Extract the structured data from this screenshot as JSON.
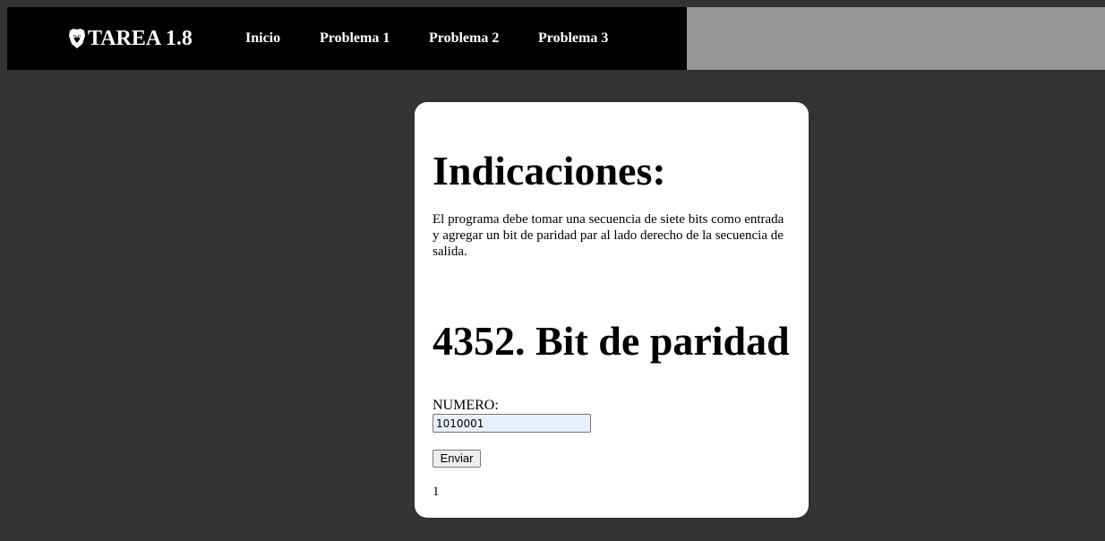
{
  "header": {
    "brand": "TAREA 1.8",
    "brand_icon": "lion-shield-icon",
    "nav": [
      {
        "label": "Inicio"
      },
      {
        "label": "Problema 1"
      },
      {
        "label": "Problema 2"
      },
      {
        "label": "Problema 3"
      }
    ]
  },
  "main": {
    "instructions_title": "Indicaciones:",
    "instructions_text": "El programa debe tomar una secuencia de siete bits como entrada y agregar un bit de paridad par al lado derecho de la secuencia de salida.",
    "problem_title": "4352. Bit de paridad",
    "form": {
      "field_label": "NUMERO:",
      "field_value": "1010001",
      "submit_label": "Enviar"
    },
    "result": "1"
  },
  "colors": {
    "page_bg": "#333333",
    "nav_bg": "#000000",
    "topbar_right_bg": "#969696",
    "card_bg": "#ffffff",
    "input_autofill_bg": "#e8f0fe"
  }
}
